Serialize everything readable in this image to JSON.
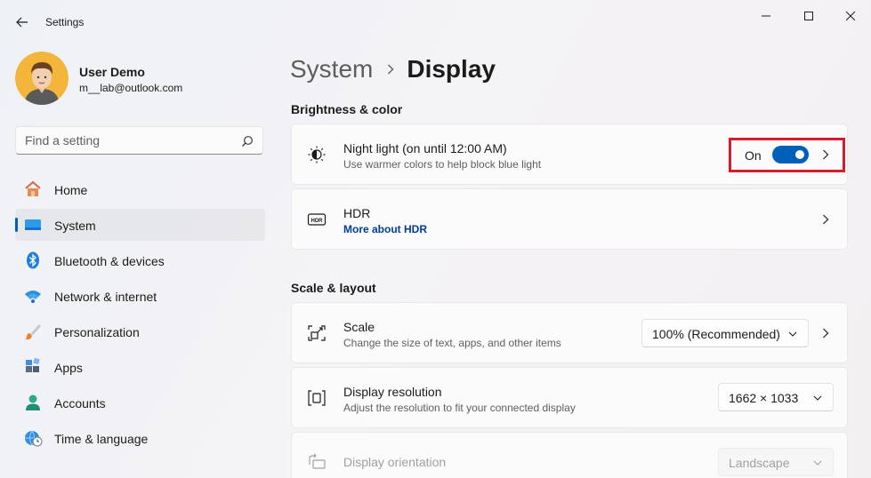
{
  "window": {
    "title": "Settings",
    "minimize_glyph": "—",
    "maximize_glyph": "☐",
    "close_glyph": "✕"
  },
  "user": {
    "name": "User Demo",
    "email": "m__lab@outlook.com"
  },
  "search": {
    "placeholder": "Find a setting",
    "icon": "search-icon"
  },
  "sidebar": {
    "items": [
      {
        "label": "Home",
        "icon": "home-icon",
        "active": false
      },
      {
        "label": "System",
        "icon": "system-icon",
        "active": true
      },
      {
        "label": "Bluetooth & devices",
        "icon": "bluetooth-icon",
        "active": false
      },
      {
        "label": "Network & internet",
        "icon": "wifi-icon",
        "active": false
      },
      {
        "label": "Personalization",
        "icon": "brush-icon",
        "active": false
      },
      {
        "label": "Apps",
        "icon": "apps-icon",
        "active": false
      },
      {
        "label": "Accounts",
        "icon": "person-icon",
        "active": false
      },
      {
        "label": "Time & language",
        "icon": "globe-clock-icon",
        "active": false
      }
    ]
  },
  "breadcrumb": {
    "parent": "System",
    "current": "Display"
  },
  "sections": {
    "brightness": {
      "title": "Brightness & color",
      "night_light": {
        "title": "Night light (on until 12:00 AM)",
        "subtitle": "Use warmer colors to help block blue light",
        "toggle_label": "On",
        "toggle_on": true,
        "icon": "night-light-icon"
      },
      "hdr": {
        "title": "HDR",
        "link": "More about HDR",
        "icon": "hdr-icon"
      }
    },
    "scale_layout": {
      "title": "Scale & layout",
      "scale": {
        "title": "Scale",
        "subtitle": "Change the size of text, apps, and other items",
        "value": "100% (Recommended)",
        "icon": "scale-icon"
      },
      "resolution": {
        "title": "Display resolution",
        "subtitle": "Adjust the resolution to fit your connected display",
        "value": "1662 × 1033",
        "icon": "resolution-icon"
      },
      "orientation": {
        "title": "Display orientation",
        "value": "Landscape",
        "icon": "orientation-icon",
        "disabled": true
      }
    }
  },
  "colors": {
    "accent": "#005fb8",
    "highlight": "#d51c2a",
    "link": "#003e92"
  }
}
